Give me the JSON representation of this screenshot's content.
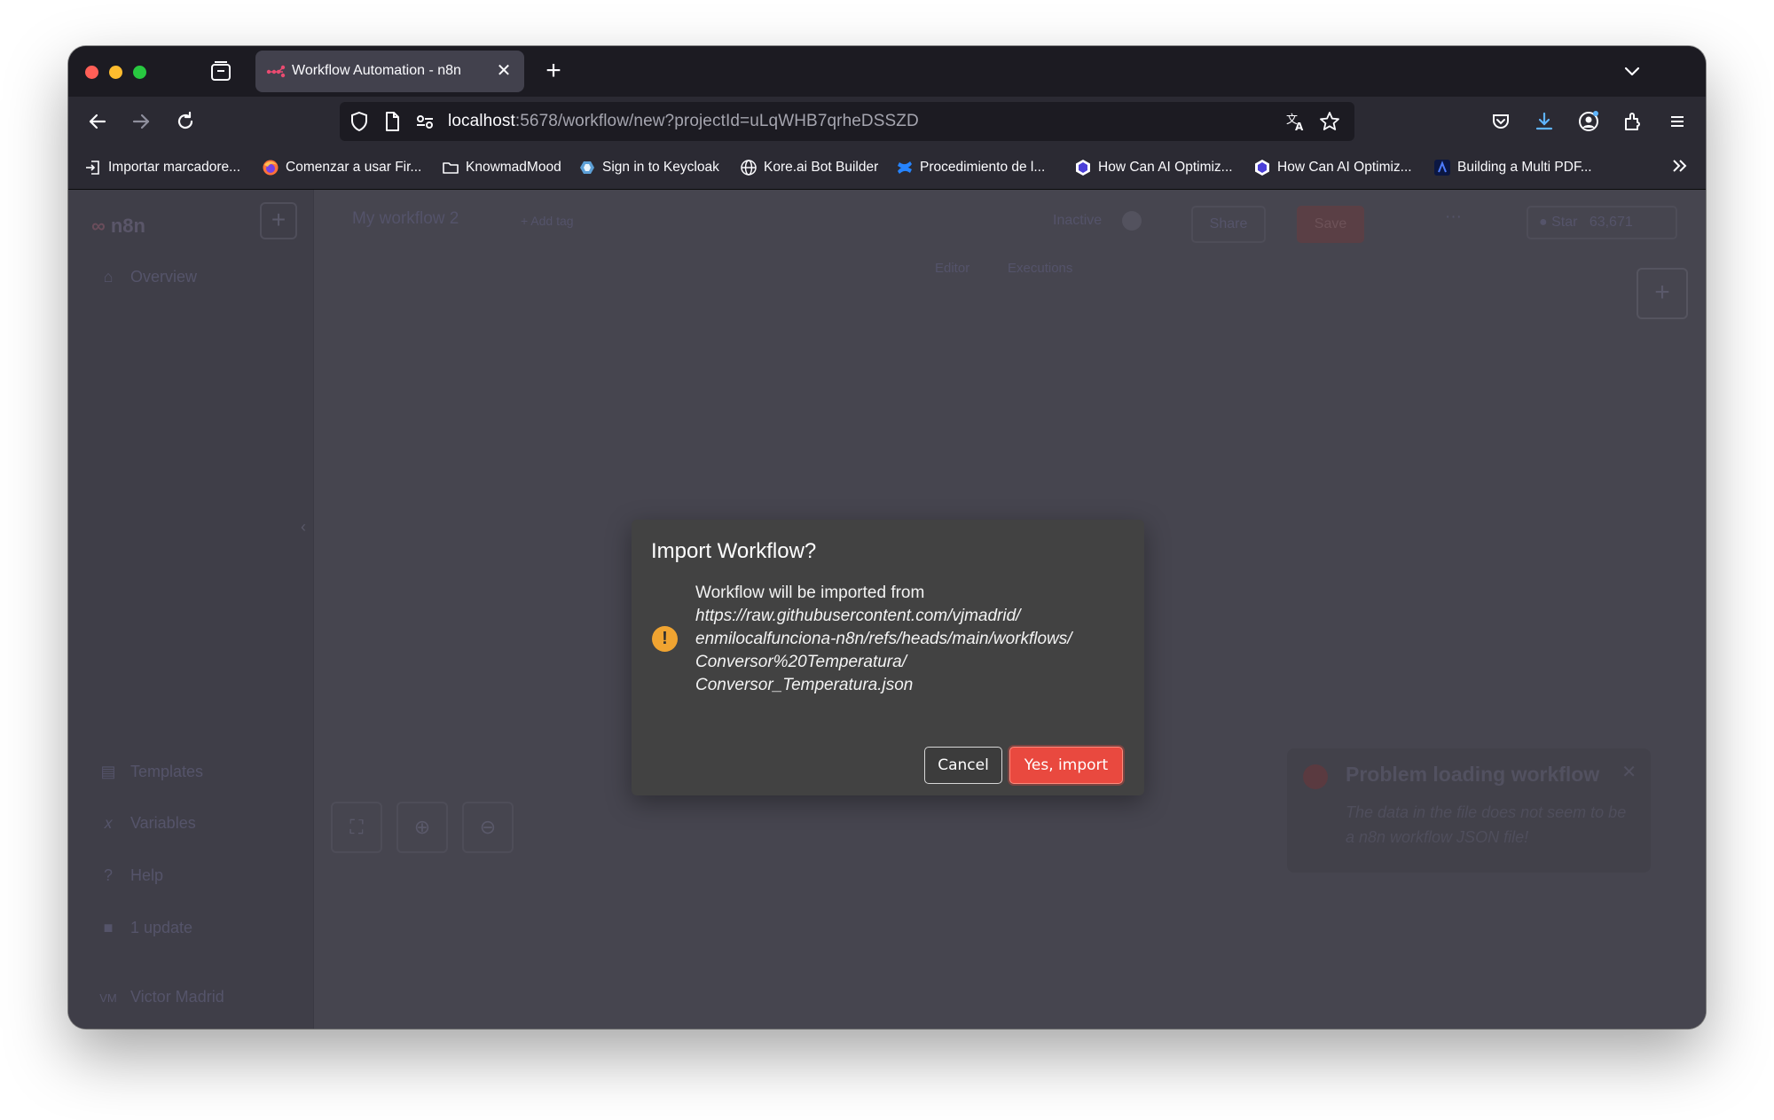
{
  "browser": {
    "tab": {
      "title": "Workflow Automation - n8n"
    },
    "url": {
      "host": "localhost",
      "rest": ":5678/workflow/new?projectId=uLqWHB7qrheDSSZD"
    },
    "bookmarks": [
      "Importar marcadore...",
      "Comenzar a usar Fir...",
      "KnowmadMood",
      "Sign in to Keycloak",
      "Kore.ai Bot Builder",
      "Procedimiento de l...",
      "How Can AI Optimiz...",
      "How Can AI Optimiz...",
      "Building a Multi PDF..."
    ]
  },
  "app": {
    "logo": "n8n",
    "sidebar": {
      "overview": "Overview",
      "templates": "Templates",
      "variables": "Variables",
      "help": "Help",
      "update": "1 update",
      "user_initials": "VM",
      "user_name": "Victor Madrid"
    },
    "header": {
      "workflow_name": "My workflow 2",
      "add_tag": "+ Add tag",
      "status": "Inactive",
      "share": "Share",
      "save": "Save",
      "star": "Star",
      "star_count": "63,671",
      "tab_editor": "Editor",
      "tab_executions": "Executions"
    },
    "toast": {
      "title": "Problem loading workflow",
      "message": "The data in the file does not seem to be a n8n workflow JSON file!"
    }
  },
  "dialog": {
    "title": "Import Workflow?",
    "intro": "Workflow will be imported from",
    "url_lines": [
      "https://raw.githubusercontent.com/vjmadrid/",
      "enmilocalfunciona-n8n/refs/heads/main/workflows/",
      "Conversor%20Temperatura/",
      "Conversor_Temperatura.json"
    ],
    "cancel": "Cancel",
    "confirm": "Yes, import"
  }
}
